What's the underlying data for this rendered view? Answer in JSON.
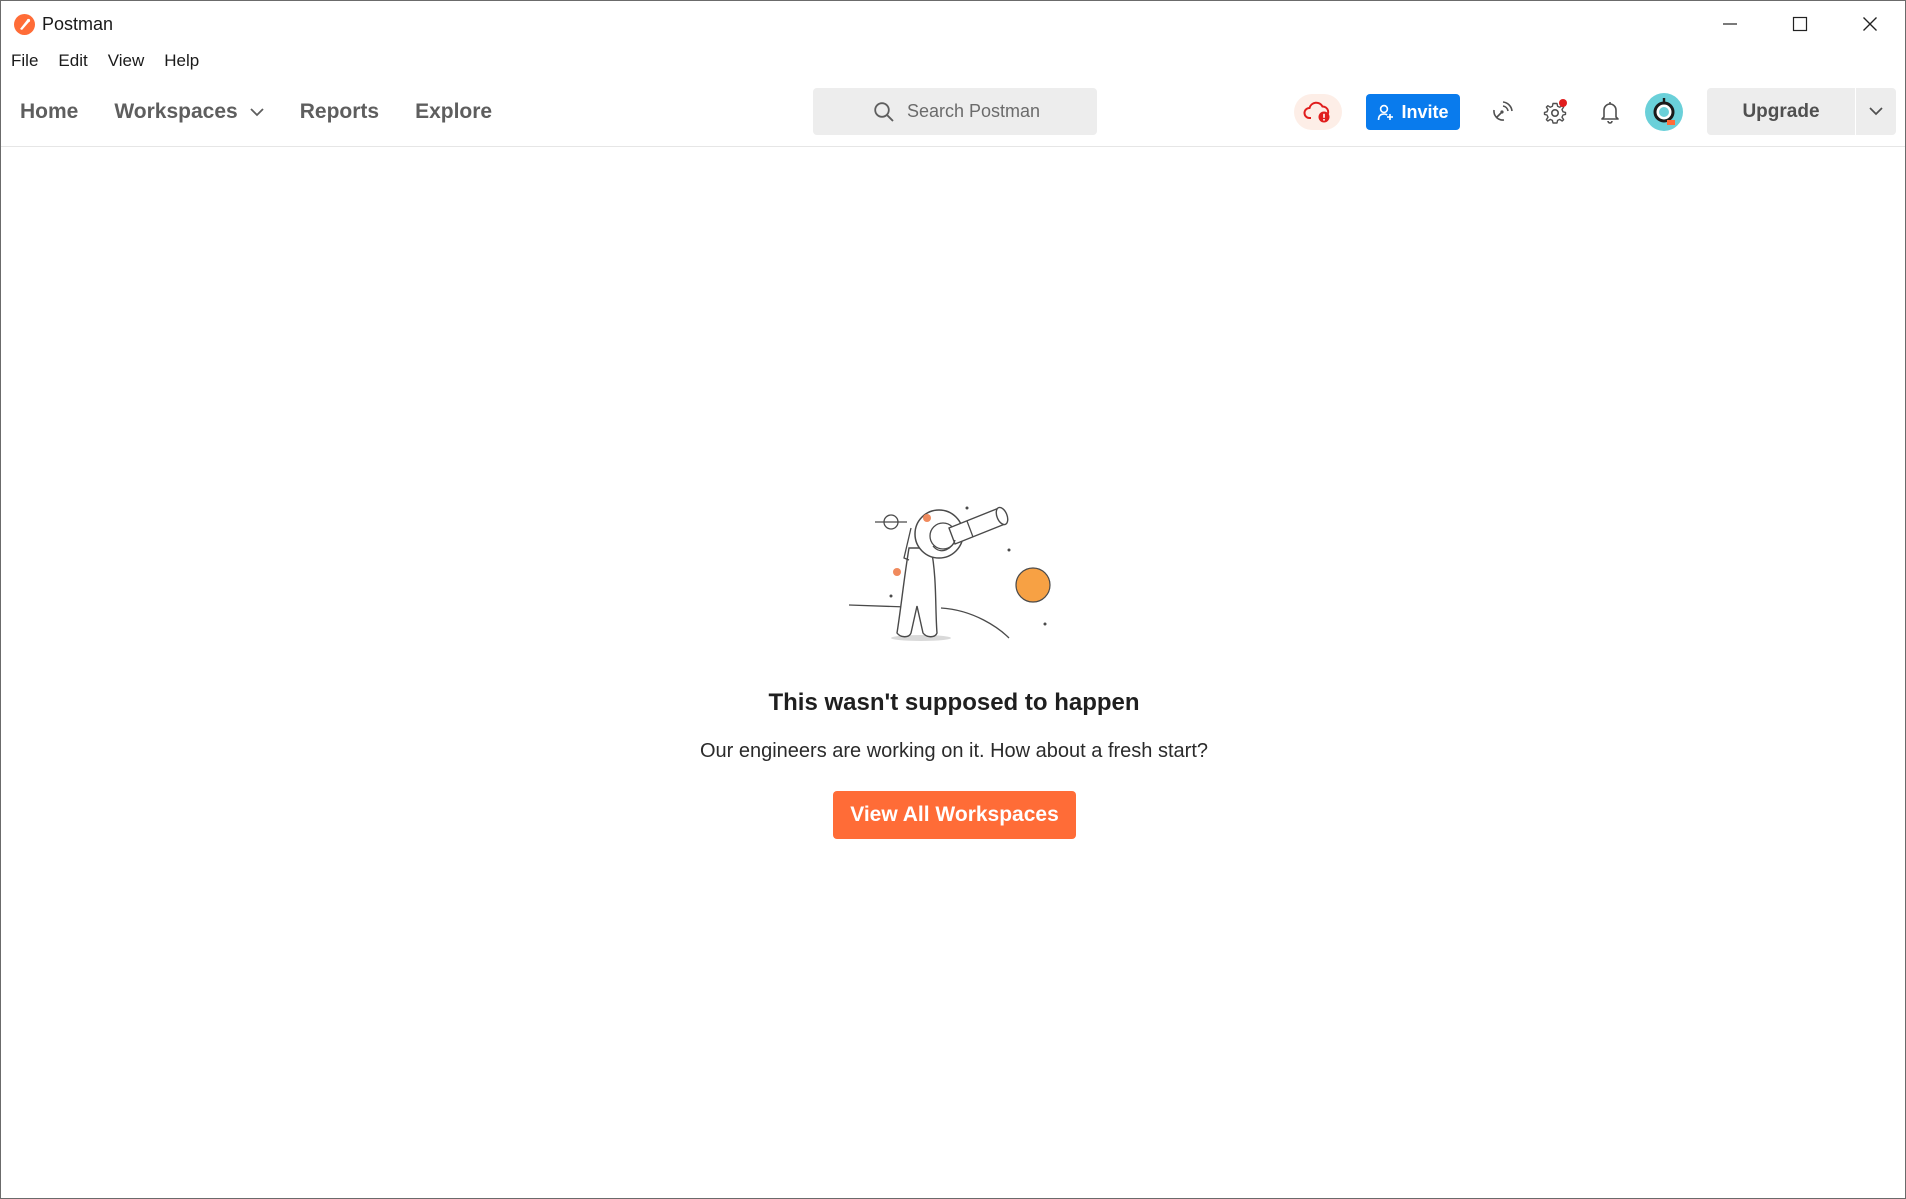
{
  "window": {
    "title": "Postman"
  },
  "menubar": {
    "items": [
      "File",
      "Edit",
      "View",
      "Help"
    ]
  },
  "nav": {
    "home": "Home",
    "workspaces": "Workspaces",
    "reports": "Reports",
    "explore": "Explore"
  },
  "search": {
    "placeholder": "Search Postman"
  },
  "header": {
    "invite_label": "Invite",
    "upgrade_label": "Upgrade"
  },
  "error": {
    "title": "This wasn't supposed to happen",
    "message": "Our engineers are working on it. How about a fresh start?",
    "cta_label": "View All Workspaces"
  },
  "colors": {
    "brand": "#ff6c37",
    "primary": "#097bed",
    "sync_bg": "#fdeee7",
    "sync_error": "#e01d1d",
    "avatar": "#6ad0d9"
  },
  "icons": [
    "postman-logo-icon",
    "minimize-icon",
    "maximize-icon",
    "close-icon",
    "chevron-down-icon",
    "search-icon",
    "cloud-sync-error-icon",
    "add-user-icon",
    "satellite-icon",
    "settings-gear-icon",
    "bell-icon",
    "astronaut-avatar-icon",
    "astronaut-telescope-illustration"
  ]
}
